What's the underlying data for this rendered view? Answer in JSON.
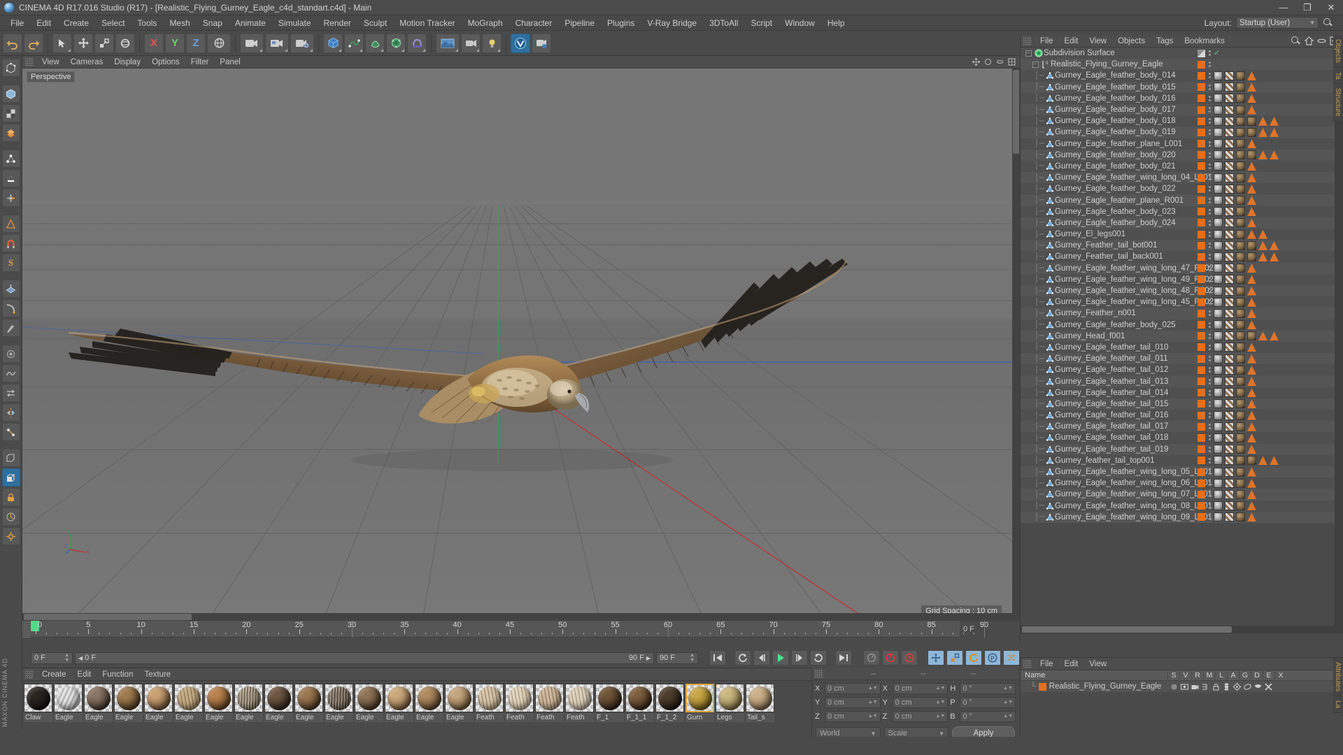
{
  "window": {
    "title": "CINEMA 4D R17.016 Studio (R17) - [Realistic_Flying_Gurney_Eagle_c4d_standart.c4d] - Main",
    "minimize": "—",
    "maximize": "❐",
    "close": "✕",
    "logo_name": "cinema4d-logo"
  },
  "menubar": {
    "items": [
      "File",
      "Edit",
      "Create",
      "Select",
      "Tools",
      "Mesh",
      "Snap",
      "Animate",
      "Simulate",
      "Render",
      "Sculpt",
      "Motion Tracker",
      "MoGraph",
      "Character",
      "Pipeline",
      "Plugins",
      "V-Ray Bridge",
      "3DToAll",
      "Script",
      "Window",
      "Help"
    ],
    "layout_label": "Layout:",
    "layout_value": "Startup (User)"
  },
  "toolbar": {
    "buttons": [
      {
        "name": "undo-button",
        "icon": "undo-arrow"
      },
      {
        "name": "redo-button",
        "icon": "redo-arrow"
      },
      {
        "name": "live-selection-tool",
        "icon": "cursor-arrow"
      },
      {
        "name": "move-tool",
        "icon": "move-cross"
      },
      {
        "name": "scale-tool",
        "icon": "scale-box"
      },
      {
        "name": "rotate-tool",
        "icon": "rotate-circle"
      },
      {
        "name": "lock-x-axis",
        "icon": "axis-x",
        "label": "X"
      },
      {
        "name": "lock-y-axis",
        "icon": "axis-y",
        "label": "Y"
      },
      {
        "name": "lock-z-axis",
        "icon": "axis-z",
        "label": "Z"
      },
      {
        "name": "world-object-coordinates",
        "icon": "globe"
      },
      {
        "name": "render-view",
        "icon": "camera-render"
      },
      {
        "name": "render-region",
        "icon": "render-region"
      },
      {
        "name": "render-settings",
        "icon": "render-gear"
      },
      {
        "name": "cube-primitive",
        "icon": "cube"
      },
      {
        "name": "spline-pen",
        "icon": "pen-spline"
      },
      {
        "name": "nurbs-generator",
        "icon": "nurbs"
      },
      {
        "name": "array-modeling",
        "icon": "array"
      },
      {
        "name": "deformer",
        "icon": "deformer"
      },
      {
        "name": "scene-environment",
        "icon": "environment"
      },
      {
        "name": "camera-object",
        "icon": "camera"
      },
      {
        "name": "light-object",
        "icon": "light-bulb"
      },
      {
        "name": "vray-bridge-button",
        "icon": "vray-logo"
      },
      {
        "name": "vray-render-button",
        "icon": "vray-render"
      }
    ]
  },
  "left_palette": {
    "buttons": [
      {
        "name": "tool-make-editable",
        "icon": "make-editable"
      },
      {
        "name": "tool-model-mode",
        "icon": "model-cube"
      },
      {
        "name": "tool-texture-mode",
        "icon": "texture-checker"
      },
      {
        "name": "tool-polygon-mode",
        "icon": "polygon-stack"
      },
      {
        "name": "tool-point-mode",
        "icon": "point-mode"
      },
      {
        "name": "tool-edge-mode",
        "icon": "edge-mode"
      },
      {
        "name": "tool-object-axis",
        "icon": "object-axis"
      },
      {
        "name": "tool-viewport-solo",
        "icon": "viewport-solo"
      },
      {
        "name": "tool-enable-axis",
        "icon": "enable-axis"
      },
      {
        "name": "tool-snap-settings",
        "icon": "snap-magnet"
      },
      {
        "name": "tool-sculpt-s",
        "icon": "sculpt-s"
      },
      {
        "name": "tool-workplane",
        "icon": "workplane"
      },
      {
        "name": "tool-magnet",
        "icon": "magnet"
      },
      {
        "name": "tool-knife",
        "icon": "knife"
      },
      {
        "name": "tool-brush",
        "icon": "brush"
      },
      {
        "name": "tool-smooth",
        "icon": "smooth"
      },
      {
        "name": "tool-transfer",
        "icon": "transfer"
      },
      {
        "name": "tool-mirror",
        "icon": "mirror"
      },
      {
        "name": "tool-weld",
        "icon": "weld"
      },
      {
        "name": "tool-bevel",
        "icon": "bevel"
      },
      {
        "name": "tool-extrude",
        "icon": "extrude"
      },
      {
        "name": "tool-lock-axis",
        "icon": "lock-padlock"
      },
      {
        "name": "tool-quantize",
        "icon": "quantize"
      },
      {
        "name": "tool-interface-settings",
        "icon": "interface-gear"
      }
    ],
    "brand": "MAXON CINEMA 4D"
  },
  "viewport": {
    "menu": [
      "View",
      "Cameras",
      "Display",
      "Options",
      "Filter",
      "Panel"
    ],
    "perspective_label": "Perspective",
    "grid_spacing": "Grid Spacing : 10 cm",
    "nav_icons": [
      "viewport-move-icon",
      "viewport-scale-icon",
      "viewport-rotate-icon",
      "viewport-maximize-icon"
    ],
    "axis_labels": {
      "x": "X",
      "y": "Y",
      "z": "Z"
    },
    "scene_subject": "flying eagle 3d model"
  },
  "timeline": {
    "ticks": [
      0,
      5,
      10,
      15,
      20,
      25,
      30,
      35,
      40,
      45,
      50,
      55,
      60,
      65,
      70,
      75,
      80,
      85,
      90
    ],
    "start_frame": "0 F",
    "end_frame": "90 F",
    "current_frame": "0 F",
    "preview_start": "0 F",
    "preview_end": "90 F",
    "fps_field": "90 F"
  },
  "animbar": {
    "buttons": [
      {
        "name": "go-to-start-button",
        "icon": "skip-start"
      },
      {
        "name": "go-to-previous-key-button",
        "icon": "prev-key"
      },
      {
        "name": "step-back-button",
        "icon": "step-back"
      },
      {
        "name": "play-button",
        "icon": "play-triangle"
      },
      {
        "name": "step-forward-button",
        "icon": "step-forward"
      },
      {
        "name": "go-to-next-key-button",
        "icon": "next-key"
      },
      {
        "name": "go-to-end-button",
        "icon": "skip-end"
      },
      {
        "name": "record-active-objects-button",
        "icon": "record-dot"
      },
      {
        "name": "autokeying-button",
        "icon": "autokey-circle"
      },
      {
        "name": "keyframe-selection-button",
        "icon": "keyframe-question"
      },
      {
        "name": "position-key-button",
        "icon": "position-key"
      },
      {
        "name": "scale-key-button",
        "icon": "scale-key"
      },
      {
        "name": "rotation-key-button",
        "icon": "rotation-key"
      },
      {
        "name": "parameter-key-button",
        "icon": "parameter-key"
      },
      {
        "name": "point-level-animation-button",
        "icon": "pla-dots"
      }
    ]
  },
  "material_manager": {
    "menu": [
      "Create",
      "Edit",
      "Function",
      "Texture"
    ],
    "materials": [
      {
        "name": "Claw",
        "color1": "#2b2520",
        "color2": "#15110e",
        "pattern": "plain"
      },
      {
        "name": "Eagle",
        "color1": "#e6e6e6",
        "color2": "#b8b8b8",
        "pattern": "stripes"
      },
      {
        "name": "Eagle",
        "color1": "#8a7463",
        "color2": "#3e3228",
        "pattern": "plain"
      },
      {
        "name": "Eagle",
        "color1": "#a07a4f",
        "color2": "#4a3620",
        "pattern": "plain"
      },
      {
        "name": "Eagle",
        "color1": "#c9a071",
        "color2": "#6b4f33",
        "pattern": "plain"
      },
      {
        "name": "Eagle",
        "color1": "#c4ab84",
        "color2": "#7a6546",
        "pattern": "streak"
      },
      {
        "name": "Eagle",
        "color1": "#b8804c",
        "color2": "#5e3e21",
        "pattern": "plain"
      },
      {
        "name": "Eagle",
        "color1": "#bcae9a",
        "color2": "#6d6250",
        "pattern": "barred"
      },
      {
        "name": "Eagle",
        "color1": "#6d5641",
        "color2": "#2b2018",
        "pattern": "plain"
      },
      {
        "name": "Eagle",
        "color1": "#9b7750",
        "color2": "#4a3422",
        "pattern": "plain"
      },
      {
        "name": "Eagle",
        "color1": "#a39482",
        "color2": "#50483c",
        "pattern": "barred"
      },
      {
        "name": "Eagle",
        "color1": "#8e7355",
        "color2": "#42331f",
        "pattern": "plain"
      },
      {
        "name": "Eagle",
        "color1": "#caa97b",
        "color2": "#76593a",
        "pattern": "plain"
      },
      {
        "name": "Eagle",
        "color1": "#b08a5e",
        "color2": "#56402a",
        "pattern": "plain"
      },
      {
        "name": "Eagle",
        "color1": "#c3a57d",
        "color2": "#6d5233",
        "pattern": "plain"
      },
      {
        "name": "Feath",
        "color1": "#d6c3a5",
        "color2": "#8a765a",
        "pattern": "streak"
      },
      {
        "name": "Feath",
        "color1": "#e0d2bb",
        "color2": "#9c8b70",
        "pattern": "streak"
      },
      {
        "name": "Feath",
        "color1": "#cdb79a",
        "color2": "#7d6a4e",
        "pattern": "streak"
      },
      {
        "name": "Feath",
        "color1": "#ddd0bb",
        "color2": "#9a8a72",
        "pattern": "streak"
      },
      {
        "name": "F_1",
        "color1": "#6e5336",
        "color2": "#2e2014",
        "pattern": "plain"
      },
      {
        "name": "F_1_1",
        "color1": "#7c5e3e",
        "color2": "#342414",
        "pattern": "plain"
      },
      {
        "name": "F_1_2",
        "color1": "#4e3d2a",
        "color2": "#1c150d",
        "pattern": "plain"
      },
      {
        "name": "Gurn",
        "color1": "#c8a545",
        "color2": "#6f5a1c",
        "pattern": "plain"
      },
      {
        "name": "Legs",
        "color1": "#c9b67f",
        "color2": "#7a6c42",
        "pattern": "plain"
      },
      {
        "name": "Tail_s",
        "color1": "#cbb088",
        "color2": "#7a6548",
        "pattern": "plain"
      }
    ]
  },
  "coordinates": {
    "header_dashes": [
      "--",
      "--",
      "--"
    ],
    "rows": [
      {
        "label": "X",
        "pos": "0 cm",
        "label2": "X",
        "size": "0 cm",
        "label3": "H",
        "rot": "0 °"
      },
      {
        "label": "Y",
        "pos": "0 cm",
        "label2": "Y",
        "size": "0 cm",
        "label3": "P",
        "rot": "0 °"
      },
      {
        "label": "Z",
        "pos": "0 cm",
        "label2": "Z",
        "size": "0 cm",
        "label3": "B",
        "rot": "0 °"
      }
    ],
    "system": "World",
    "mode": "Scale",
    "apply": "Apply"
  },
  "object_manager": {
    "menu": [
      "File",
      "Edit",
      "View",
      "Objects",
      "Tags",
      "Bookmarks"
    ],
    "tools": [
      "search-icon",
      "home-icon",
      "ellipse-icon",
      "fit-icon"
    ],
    "side_tabs": [
      "Objects",
      "Ta",
      "Structure"
    ],
    "root": {
      "name": "Subdivision Surface",
      "icon": "subdivision-surface-icon",
      "has_checkmark": true
    },
    "child": {
      "name": "Realistic_Flying_Gurney_Eagle",
      "icon": "null-object-icon"
    },
    "objects": [
      "Gurney_Eagle_feather_body_014",
      "Gurney_Eagle_feather_body_015",
      "Gurney_Eagle_feather_body_016",
      "Gurney_Eagle_feather_body_017",
      "Gurney_Eagle_feather_body_018",
      "Gurney_Eagle_feather_body_019",
      "Gurney_Eagle_feather_plane_L001",
      "Gurney_Eagle_feather_body_020",
      "Gurney_Eagle_feather_body_021",
      "Gurney_Eagle_feather_wing_long_04_L001",
      "Gurney_Eagle_feather_body_022",
      "Gurney_Eagle_feather_plane_R001",
      "Gurney_Eagle_feather_body_023",
      "Gurney_Eagle_feather_body_024",
      "Gurney_El_legs001",
      "Gurney_Feather_tail_bot001",
      "Gurney_Feather_tail_back001",
      "Gurney_Eagle_feather_wing_long_47_R002",
      "Gurney_Eagle_feather_wing_long_49_R002",
      "Gurney_Eagle_feather_wing_long_48_R002",
      "Gurney_Eagle_feather_wing_long_45_R002",
      "Gurney_Feather_n001",
      "Gurney_Eagle_feather_body_025",
      "Gurney_Head_f001",
      "Gurney_Eagle_feather_tail_010",
      "Gurney_Eagle_feather_tail_011",
      "Gurney_Eagle_feather_tail_012",
      "Gurney_Eagle_feather_tail_013",
      "Gurney_Eagle_feather_tail_014",
      "Gurney_Eagle_feather_tail_015",
      "Gurney_Eagle_feather_tail_016",
      "Gurney_Eagle_feather_tail_017",
      "Gurney_Eagle_feather_tail_018",
      "Gurney_Eagle_feather_tail_019",
      "Gurney_feather_tail_top001",
      "Gurney_Eagle_feather_wing_long_05_L001",
      "Gurney_Eagle_feather_wing_long_06_L001",
      "Gurney_Eagle_feather_wing_long_07_L001",
      "Gurney_Eagle_feather_wing_long_08_L001",
      "Gurney_Eagle_feather_wing_long_09_L001"
    ],
    "layer_color": "#e2701f"
  },
  "layer_manager": {
    "menu": [
      "File",
      "Edit",
      "View"
    ],
    "columns": [
      "S",
      "V",
      "R",
      "M",
      "L",
      "A",
      "G",
      "D",
      "E",
      "X"
    ],
    "name_column": "Name",
    "row": {
      "name": "Realistic_Flying_Gurney_Eagle",
      "color": "#e2701f"
    },
    "side_tabs": [
      "Attributes",
      "La"
    ]
  },
  "colors": {
    "panel_bg": "#4a4a4a",
    "panel_alt": "#555555",
    "accent_orange": "#e2701f",
    "accent_blue": "#2f6f9e",
    "text": "#cfcfcf",
    "viewport_bg": "#6f6f6f",
    "grid_line": "#5a5a5a",
    "axis_x": "#c0392b",
    "axis_y": "#27ae60",
    "axis_z": "#3b5fb5",
    "playhead_green": "#55d98a"
  }
}
